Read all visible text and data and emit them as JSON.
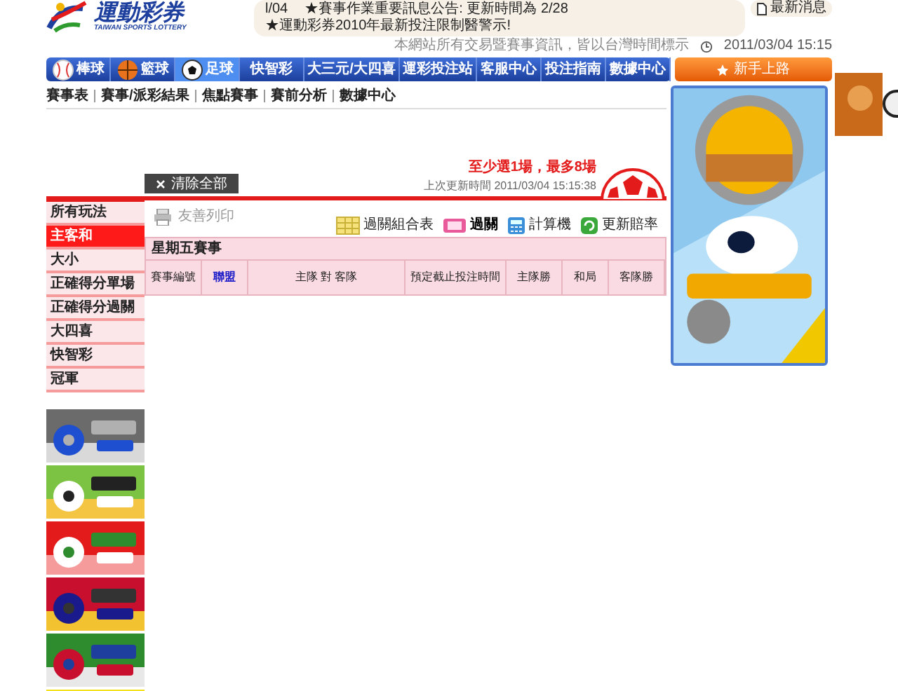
{
  "logo": {
    "title": "運動彩券",
    "subtitle": "TAIWAN SPORTS LOTTERY"
  },
  "ticker": {
    "items": [
      "l/04",
      "★賽事作業重要訊息公告: 更新時間為 2/28",
      "★運動彩券2010年最新投注限制醫警示!"
    ],
    "news_button": "最新消息",
    "notice": "本網站所有交易暨賽事資訊，皆以台灣時間標示",
    "datetime": "2011/03/04 15:15"
  },
  "nav": [
    {
      "label": "棒球",
      "kind": "baseball",
      "selected": false
    },
    {
      "label": "籃球",
      "kind": "basketball",
      "selected": false
    },
    {
      "label": "足球",
      "kind": "soccer",
      "selected": true
    },
    {
      "label": "快智彩",
      "kind": "text",
      "selected": false
    },
    {
      "label": "大三元/大四喜",
      "kind": "text",
      "selected": false
    },
    {
      "label": "運彩投注站",
      "kind": "text",
      "selected": false
    },
    {
      "label": "客服中心",
      "kind": "text",
      "selected": false
    },
    {
      "label": "投注指南",
      "kind": "text",
      "selected": false
    },
    {
      "label": "數據中心",
      "kind": "text",
      "selected": false
    }
  ],
  "newbie_button": "新手上路",
  "subnav": [
    "賽事表",
    "賽事/派彩結果",
    "焦點賽事",
    "賽前分析",
    "數據中心"
  ],
  "clear_button": "清除全部",
  "rule": "至少選1場，最多8場",
  "last_update": "上次更新時間 2011/03/04 15:15:38",
  "sidebar": [
    {
      "label": "所有玩法",
      "selected": false
    },
    {
      "label": "主客和",
      "selected": true
    },
    {
      "label": "大小",
      "selected": false
    },
    {
      "label": "正確得分單場",
      "selected": false
    },
    {
      "label": "正確得分過關",
      "selected": false
    },
    {
      "label": "大四喜",
      "selected": false
    },
    {
      "label": "快智彩",
      "selected": false
    },
    {
      "label": "冠軍",
      "selected": false
    }
  ],
  "print_link": "友善列印",
  "tools": [
    {
      "label": "過關組合表",
      "kind": "table",
      "selected": false
    },
    {
      "label": "過關",
      "kind": "parlay",
      "selected": true
    },
    {
      "label": "計算機",
      "kind": "calculator",
      "selected": false
    },
    {
      "label": "更新賠率",
      "kind": "refresh",
      "selected": false
    }
  ],
  "table": {
    "section": "星期五賽事",
    "columns": [
      "賽事編號",
      "聯盟",
      "主隊 對 客隊",
      "預定截止投注時間",
      "主隊勝",
      "和局",
      "客隊勝"
    ]
  }
}
